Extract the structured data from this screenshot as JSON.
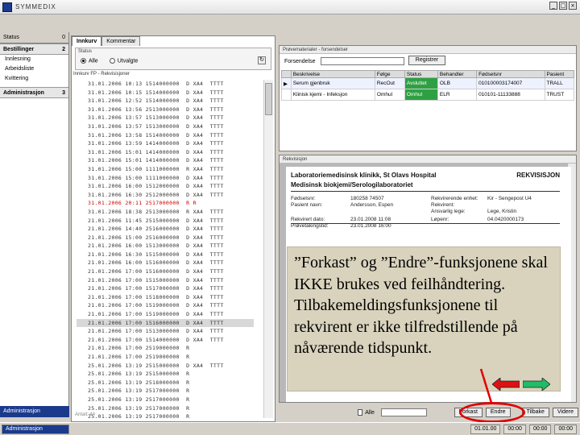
{
  "window": {
    "title": "SYMMEDIX"
  },
  "leftnav": {
    "header_label": "Status",
    "header_count": "0",
    "section1": {
      "label": "Bestillinger",
      "count": "2"
    },
    "items": [
      "Innlesning",
      "Arbeidsliste",
      "Kvittering"
    ],
    "section2": {
      "label": "Administrasjon",
      "count": "3"
    },
    "footer": "Administrasjon"
  },
  "listpanel": {
    "tabs": [
      "Innkurv",
      "Kommentar"
    ],
    "status_label": "Status",
    "radio_all": "Alle",
    "radio_other": "Utvalgte",
    "list_title": "Innkurv FP - Rekvisisjoner",
    "footer_text": "Antall: 44",
    "rows": [
      {
        "t": "31.01.2006 10:13 1514000000  D XA4  TTTT"
      },
      {
        "t": "31.01.2006 10:15 1514000000  D XA4  TTTT"
      },
      {
        "t": "31.01.2006 12:52 1514000000  D XA4  TTTT"
      },
      {
        "t": "31.01.2006 13:56 2513000000  D XA4  TTTT"
      },
      {
        "t": "31.01.2006 13:57 1513000000  D XA4  TTTT"
      },
      {
        "t": "31.01.2006 13:57 1513000000  D XA4  TTTT"
      },
      {
        "t": "31.01.2006 13:58 1514000000  D XA4  TTTT"
      },
      {
        "t": "31.01.2006 13:59 1414000000  D XA4  TTTT"
      },
      {
        "t": "31.01.2006 15:01 1414000000  D XA4  TTTT"
      },
      {
        "t": "31.01.2006 15:01 1414000000  D XA4  TTTT"
      },
      {
        "t": "31.01.2006 15:00 1111000000  R XA4  TTTT"
      },
      {
        "t": "31.01.2006 15:00 1111000000  D XA4  TTTT"
      },
      {
        "t": "31.01.2006 16:00 1512000000  D XA4  TTTT"
      },
      {
        "t": "31.01.2006 16:30 2512000000  D XA4  TTTT"
      },
      {
        "t": "31.01.2006 20:11 2517000000  R R",
        "red": true
      },
      {
        "t": "31.01.2006 18:38 2513000000  R XA4  TTTT"
      },
      {
        "t": "21.01.2006 11:45 2515000000  D XA4  TTTT"
      },
      {
        "t": "21.01.2006 14:40 2516000000  D XA4  TTTT"
      },
      {
        "t": "21.01.2006 15:00 2516000000  D XA4  TTTT"
      },
      {
        "t": "21.01.2006 16:00 1513000000  D XA4  TTTT"
      },
      {
        "t": "21.01.2006 16:30 1515000000  D XA4  TTTT"
      },
      {
        "t": "21.01.2006 16:00 1516000000  D XA4  TTTT"
      },
      {
        "t": "21.01.2006 17:00 1516000000  D XA4  TTTT"
      },
      {
        "t": "21.01.2006 17:00 1515000000  D XA4  TTTT"
      },
      {
        "t": "21.01.2006 17:00 1517000000  D XA4  TTTT"
      },
      {
        "t": "21.01.2006 17:00 1518000000  D XA4  TTTT"
      },
      {
        "t": "21.01.2006 17:00 1519000000  D XA4  TTTT"
      },
      {
        "t": "21.01.2006 17:00 1519000000  D XA4  TTTT"
      },
      {
        "t": "21.01.2006 17:00 1516000000  D XA4  TTTT",
        "sel": true
      },
      {
        "t": "21.01.2006 17:00 1513000000  D XA4  TTTT"
      },
      {
        "t": "21.01.2006 17:00 1514000000  D XA4  TTTT"
      },
      {
        "t": "21.01.2006 17:00 2519000000  R"
      },
      {
        "t": "21.01.2006 17:00 2519000000  R"
      },
      {
        "t": "25.01.2006 13:19 2515000000  D XA4  TTTT"
      },
      {
        "t": "25.01.2006 13:19 2515000000  R"
      },
      {
        "t": "25.01.2006 13:19 2518000000  R"
      },
      {
        "t": "25.01.2006 13:19 2517000000  R"
      },
      {
        "t": "25.01.2006 13:19 2517000000  R"
      },
      {
        "t": "25.01.2006 13:19 2517000000  R"
      },
      {
        "t": "25.01.2006 13:19 2517000000  R"
      },
      {
        "t": "25.01.2006 13:19 2518000000  D XA4  TTTT"
      },
      {
        "t": "25.01.2006 13:19 2517000000  D XA4  TTTT"
      },
      {
        "t": "25.01.2006 13:19 2519000000  D XA4  TTTT"
      }
    ]
  },
  "requests": {
    "title": "Prøvematerialer - forsendelser",
    "filter_label": "Forsendelse",
    "filter_value": "",
    "button": "Registrer",
    "columns": [
      "",
      "Beskrivelse",
      "Følge",
      "Status",
      "Behandler",
      "Fødselsnr",
      "Pasient"
    ],
    "rows": [
      [
        "▶",
        "Serum gjenbruk",
        "RecOut",
        "Avsluttet",
        "OLB",
        "010100003174007",
        "TRALL"
      ],
      [
        "",
        "Klinisk kjemi - Infeksjon",
        "Omhul",
        "Omhul",
        "ELR",
        "010101-11133888",
        "TRUST"
      ]
    ]
  },
  "document": {
    "panel_title": "Rekvisisjon",
    "hospital": "Laboratoriemedisinsk klinikk, St Olavs Hospital",
    "department": "Medisinsk biokjemi/Serologilaboratoriet",
    "doc_title": "REKVISISJON",
    "fields": [
      {
        "k": "Fødselsnr:",
        "v": "180258 74507",
        "k2": "Rekvirerende enhet:",
        "v2": "Kir - Sengepost U4"
      },
      {
        "k": "Pasient navn:",
        "v": "Andersson, Espen",
        "k2": "Rekvirent:",
        "v2": ""
      },
      {
        "k": "",
        "v": "",
        "k2": "Ansvarlig lege:",
        "v2": "Lege, Kristin"
      },
      {
        "k": "Rekvirert dato:",
        "v": "23.01.2008 11:08",
        "k2": "Løpenr:",
        "v2": "04.0420000173"
      },
      {
        "k": "Prøvetakingstid:",
        "v": "23.01.2008 16:00",
        "k2": "",
        "v2": ""
      }
    ]
  },
  "overlay": {
    "text": "”Forkast” og ”Endre”-funksjonene skal IKKE brukes ved feilhåndtering. Tilbakemeldingsfunksjonene til rekvirent er ikke tilfredstillende på nåværende tidspunkt."
  },
  "bottombar": {
    "checkbox_label": "Alle",
    "buttons": [
      "Forkast",
      "Endre",
      "Tilbake",
      "Videre"
    ]
  },
  "statusbar": {
    "left": "Administrasjon",
    "right_cells": [
      "01.01.00",
      "00:00",
      "00:00",
      "00:00"
    ]
  },
  "colors": {
    "brand": "#1b3a8c",
    "status_green": "#2ea043",
    "ring": "#e00000",
    "arrow_left": "#dd1111",
    "arrow_right": "#22bb66"
  }
}
